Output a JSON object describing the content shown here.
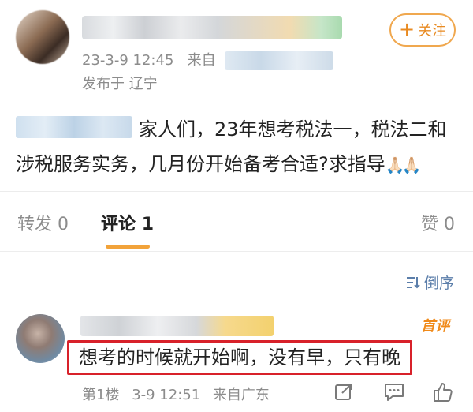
{
  "post": {
    "timestamp": "23-3-9 12:45",
    "source_label": "来自",
    "location": "发布于 辽宁",
    "follow_label": "关注",
    "follow_icon": "plus-icon",
    "text": "家人们，23年想考税法一，税法二和涉税服务实务，几月份开始备考合适?求指导",
    "emoji": "🙏🏻🙏🏻"
  },
  "tabs": [
    {
      "label": "转发",
      "count": "0"
    },
    {
      "label": "评论",
      "count": "1"
    },
    {
      "label": "赞",
      "count": "0"
    }
  ],
  "sort_label": "倒序",
  "comment": {
    "badge": "首评",
    "text": "想考的时候就开始啊，没有早，只有晚",
    "floor": "第1楼",
    "time": "3-9 12:51",
    "source": "来自广东"
  },
  "colors": {
    "accent": "#f2a33a",
    "link": "#5b7eaa",
    "highlight_border": "#d8212a"
  }
}
